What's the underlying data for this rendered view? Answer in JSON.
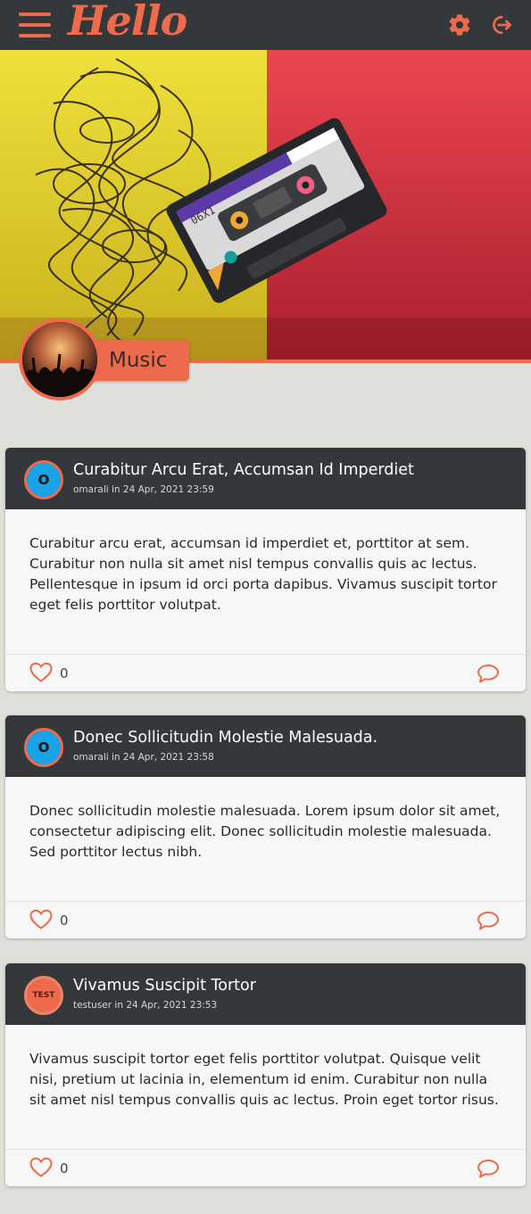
{
  "app": {
    "logo_text": "Hello",
    "accent_color": "#ee6a4c",
    "header_bg": "#35383b",
    "icons": {
      "menu": "hamburger-menu-icon",
      "settings": "gear-icon",
      "logout": "logout-icon"
    }
  },
  "group": {
    "name": "Music",
    "cover_image": "cassette-tape-on-yellow-red",
    "avatar_image": "concert-crowd"
  },
  "posts": [
    {
      "avatar_text": "O",
      "title": "Curabitur Arcu Erat, Accumsan Id Imperdiet",
      "meta": "omarali in 24 Apr, 2021 23:59",
      "body": "Curabitur arcu erat, accumsan id imperdiet et, porttitor at sem. Curabitur non nulla sit amet nisl tempus convallis quis ac lectus. Pellentesque in ipsum id orci porta dapibus. Vivamus suscipit tortor eget felis porttitor volutpat.",
      "likes": "0"
    },
    {
      "avatar_text": "O",
      "title": "Donec Sollicitudin Molestie Malesuada.",
      "meta": "omarali in 24 Apr, 2021 23:58",
      "body": "Donec sollicitudin molestie malesuada. Lorem ipsum dolor sit amet, consectetur adipiscing elit. Donec sollicitudin molestie malesuada. Sed porttitor lectus nibh.",
      "likes": "0"
    },
    {
      "avatar_text": "TEST",
      "title": "Vivamus Suscipit Tortor",
      "meta": "testuser in 24 Apr, 2021 23:53",
      "body": "Vivamus suscipit tortor eget felis porttitor volutpat. Quisque velit nisi, pretium ut lacinia in, elementum id enim. Curabitur non nulla sit amet nisl tempus convallis quis ac lectus. Proin eget tortor risus.",
      "likes": "0"
    }
  ]
}
